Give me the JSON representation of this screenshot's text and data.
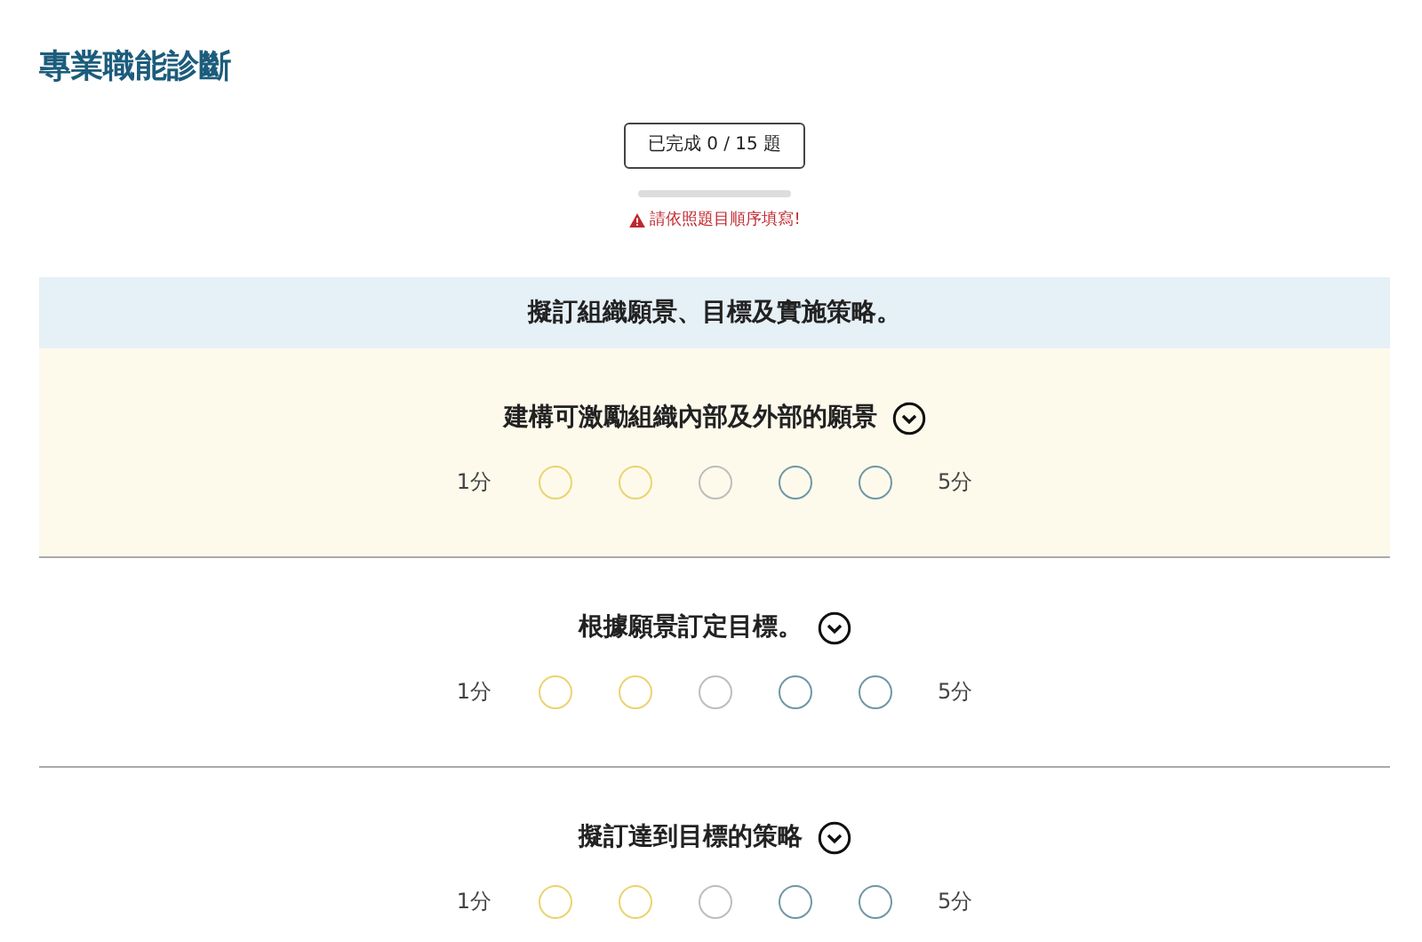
{
  "page_title": "專業職能診斷",
  "progress": {
    "label": "已完成 0 / 15 題",
    "level": 0
  },
  "warning": "請依照題目順序填寫!",
  "section": {
    "title": "擬訂組織願景、目標及實施策略。"
  },
  "questions": [
    {
      "text": "建構可激勵組織內部及外部的願景",
      "active": true,
      "min_label": "1分",
      "max_label": "5分",
      "options": [
        {
          "selected": false,
          "color": "#ecd36f"
        },
        {
          "selected": false,
          "color": "#ecd36f"
        },
        {
          "selected": false,
          "color": "#bdbdbd"
        },
        {
          "selected": false,
          "color": "#6f97a5"
        },
        {
          "selected": false,
          "color": "#6f97a5"
        }
      ]
    },
    {
      "text": "根據願景訂定目標。",
      "active": false,
      "min_label": "1分",
      "max_label": "5分",
      "options": [
        {
          "selected": false,
          "color": "#ecd36f"
        },
        {
          "selected": false,
          "color": "#ecd36f"
        },
        {
          "selected": false,
          "color": "#bdbdbd"
        },
        {
          "selected": false,
          "color": "#6f97a5"
        },
        {
          "selected": false,
          "color": "#6f97a5"
        }
      ]
    },
    {
      "text": "擬訂達到目標的策略",
      "active": false,
      "min_label": "1分",
      "max_label": "5分",
      "options": [
        {
          "selected": false,
          "color": "#ecd36f"
        },
        {
          "selected": false,
          "color": "#ecd36f"
        },
        {
          "selected": false,
          "color": "#bdbdbd"
        },
        {
          "selected": false,
          "color": "#6f97a5"
        },
        {
          "selected": false,
          "color": "#6f97a5"
        }
      ]
    }
  ]
}
